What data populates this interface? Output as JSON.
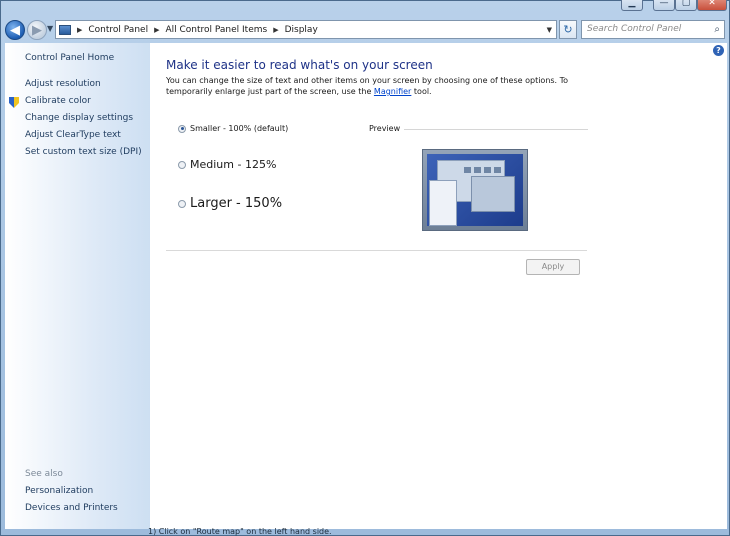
{
  "address": {
    "crumbs": [
      "Control Panel",
      "All Control Panel Items",
      "Display"
    ]
  },
  "search": {
    "placeholder": "Search Control Panel"
  },
  "sidebar": {
    "home": "Control Panel Home",
    "links": [
      "Adjust resolution",
      "Calibrate color",
      "Change display settings",
      "Adjust ClearType text",
      "Set custom text size (DPI)"
    ],
    "see_also_title": "See also",
    "see_also": [
      "Personalization",
      "Devices and Printers"
    ]
  },
  "main": {
    "title": "Make it easier to read what's on your screen",
    "desc_part1": "You can change the size of text and other items on your screen by choosing one of these options. To temporarily enlarge just part of the screen, use the",
    "desc_link": "Magnifier",
    "desc_part2": "tool.",
    "options": [
      {
        "label": "Smaller - 100% (default)",
        "selected": true
      },
      {
        "label": "Medium - 125%",
        "selected": false
      },
      {
        "label": "Larger - 150%",
        "selected": false
      }
    ],
    "preview_label": "Preview",
    "apply_label": "Apply"
  },
  "background_text": "1) Click on \"Route map\" on the left hand side."
}
